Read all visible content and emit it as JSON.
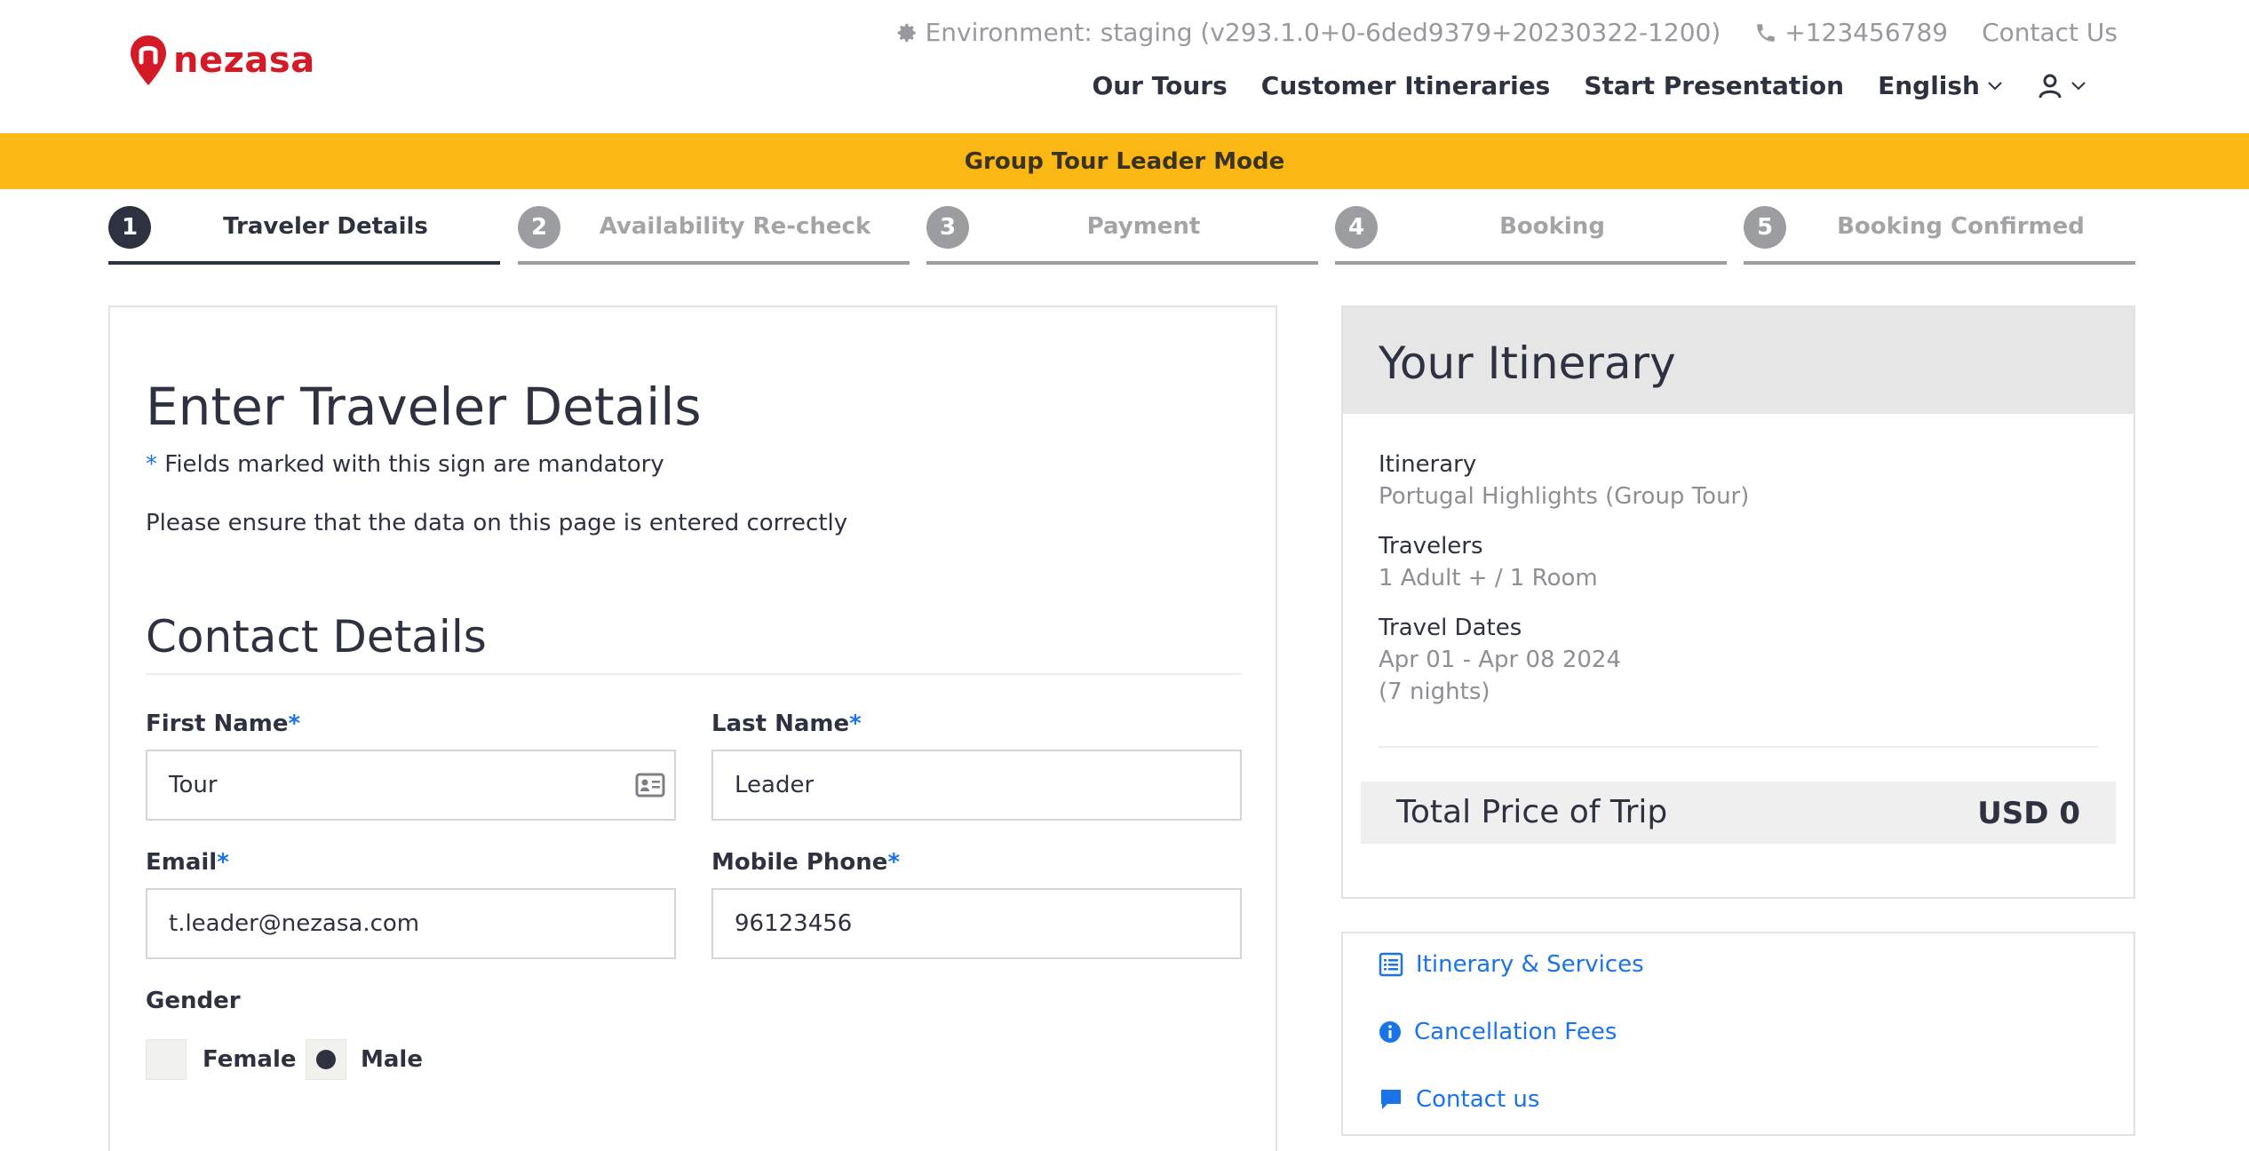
{
  "brand": {
    "name": "nezasa",
    "color": "#d31a26"
  },
  "topbar": {
    "environment": "Environment: staging (v293.1.0+0-6ded9379+20230322-1200)",
    "phone": "+123456789",
    "contact": "Contact Us"
  },
  "nav": {
    "our_tours": "Our Tours",
    "customer_itineraries": "Customer Itineraries",
    "start_presentation": "Start Presentation",
    "language": "English"
  },
  "banner": {
    "text": "Group Tour Leader Mode",
    "color": "#fbb714"
  },
  "steps": [
    {
      "num": "1",
      "label": "Traveler Details",
      "active": true
    },
    {
      "num": "2",
      "label": "Availability Re-check",
      "active": false
    },
    {
      "num": "3",
      "label": "Payment",
      "active": false
    },
    {
      "num": "4",
      "label": "Booking",
      "active": false
    },
    {
      "num": "5",
      "label": "Booking Confirmed",
      "active": false
    }
  ],
  "form": {
    "title": "Enter Traveler Details",
    "mandatory_star": "*",
    "mandatory_note": "Fields marked with this sign are mandatory",
    "ensure_note": "Please ensure that the data on this page is entered correctly",
    "section_title": "Contact Details",
    "first_name": {
      "label": "First Name",
      "value": "Tour"
    },
    "last_name": {
      "label": "Last Name",
      "value": "Leader"
    },
    "email": {
      "label": "Email",
      "value": "t.leader@nezasa.com"
    },
    "mobile_phone": {
      "label": "Mobile Phone",
      "value": "96123456"
    },
    "required_mark": "*",
    "gender": {
      "label": "Gender",
      "options": [
        "Female",
        "Male"
      ],
      "selected": "Male"
    }
  },
  "itinerary": {
    "title": "Your Itinerary",
    "itinerary_label": "Itinerary",
    "itinerary_value": "Portugal Highlights (Group Tour)",
    "travelers_label": "Travelers",
    "travelers_value": "1 Adult + / 1 Room",
    "dates_label": "Travel Dates",
    "dates_value": "Apr 01 - Apr 08 2024",
    "nights_value": "(7 nights)",
    "total_label": "Total Price of Trip",
    "total_value": "USD 0"
  },
  "links": {
    "itinerary_services": "Itinerary & Services",
    "cancellation_fees": "Cancellation Fees",
    "contact_us": "Contact us"
  },
  "colors": {
    "text": "#2e3140",
    "link": "#1a73e8",
    "muted": "#97999f"
  }
}
